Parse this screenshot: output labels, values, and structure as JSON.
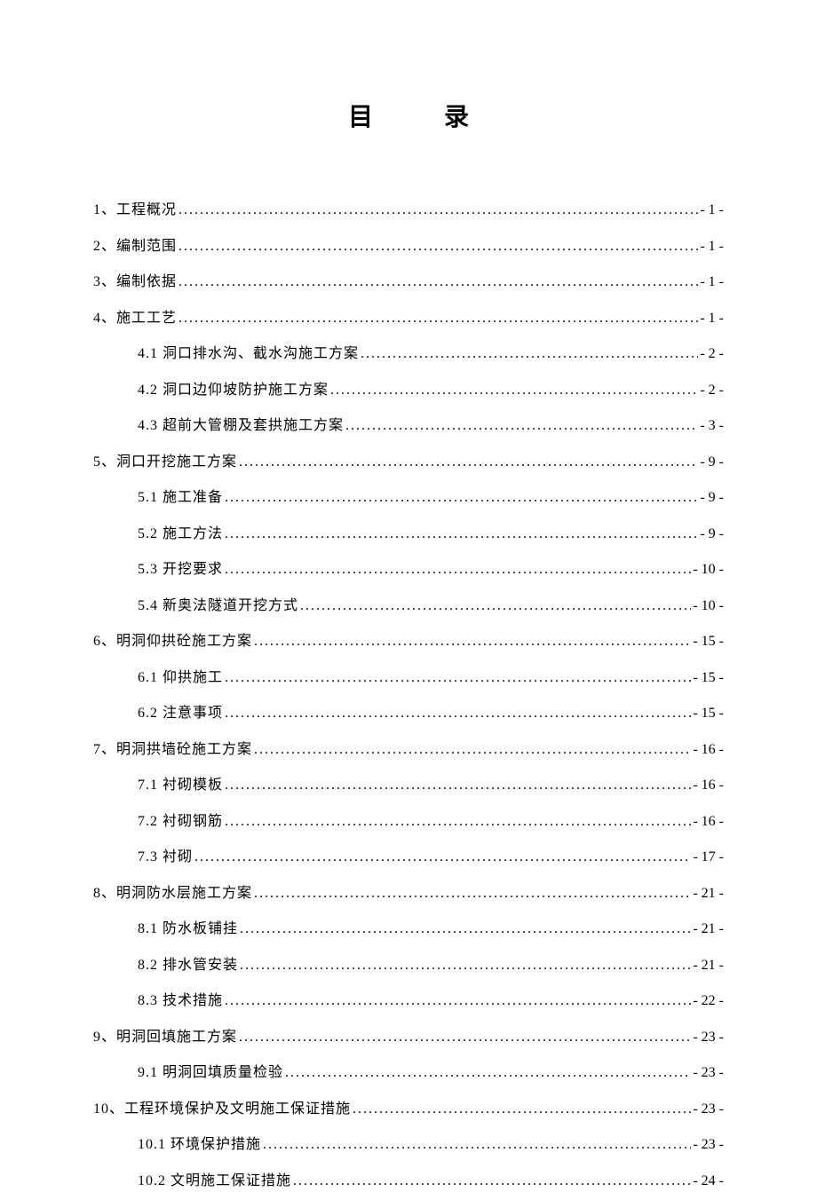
{
  "title": "目录",
  "toc": [
    {
      "level": 1,
      "label": "1、工程概况 ",
      "page": "- 1 -"
    },
    {
      "level": 1,
      "label": "2、编制范围 ",
      "page": "- 1 -"
    },
    {
      "level": 1,
      "label": "3、编制依据 ",
      "page": "- 1 -"
    },
    {
      "level": 1,
      "label": "4、施工工艺 ",
      "page": "- 1 -"
    },
    {
      "level": 2,
      "label": "4.1 洞口排水沟、截水沟施工方案",
      "page": "- 2 -"
    },
    {
      "level": 2,
      "label": "4.2 洞口边仰坡防护施工方案",
      "page": "- 2 -"
    },
    {
      "level": 2,
      "label": "4.3 超前大管棚及套拱施工方案",
      "page": "- 3 -"
    },
    {
      "level": 1,
      "label": "5、洞口开挖施工方案",
      "page": "- 9 -"
    },
    {
      "level": 2,
      "label": "5.1 施工准备",
      "page": "- 9 -"
    },
    {
      "level": 2,
      "label": "5.2 施工方法",
      "page": "- 9 -"
    },
    {
      "level": 2,
      "label": "5.3 开挖要求",
      "page": "- 10 -"
    },
    {
      "level": 2,
      "label": "5.4 新奥法隧道开挖方式 ",
      "page": "- 10 -"
    },
    {
      "level": 1,
      "label": "6、明洞仰拱砼施工方案",
      "page": "- 15 -"
    },
    {
      "level": 2,
      "label": "6.1 仰拱施工",
      "page": "- 15 -"
    },
    {
      "level": 2,
      "label": "6.2 注意事项",
      "page": "- 15 -"
    },
    {
      "level": 1,
      "label": "7、明洞拱墙砼施工方案",
      "page": "- 16 -"
    },
    {
      "level": 2,
      "label": "7.1 衬砌模板",
      "page": "- 16 -"
    },
    {
      "level": 2,
      "label": "7.2 衬砌钢筋",
      "page": "- 16 -"
    },
    {
      "level": 2,
      "label": "7.3 衬砌",
      "page": "- 17 -"
    },
    {
      "level": 1,
      "label": "8、明洞防水层施工方案",
      "page": "- 21 -"
    },
    {
      "level": 2,
      "label": "8.1 防水板铺挂 ",
      "page": "- 21 -"
    },
    {
      "level": 2,
      "label": "8.2 排水管安装 ",
      "page": "- 21 -"
    },
    {
      "level": 2,
      "label": "8.3 技术措施",
      "page": "- 22 -"
    },
    {
      "level": 1,
      "label": "9、明洞回填施工方案",
      "page": "- 23 -"
    },
    {
      "level": 2,
      "label": "9.1 明洞回填质量检验 ",
      "page": "- 23 -"
    },
    {
      "level": 1,
      "label": "10、工程环境保护及文明施工保证措施 ",
      "page": "- 23 -"
    },
    {
      "level": 2,
      "label": "10.1 环境保护措施 ",
      "page": "- 23 -"
    },
    {
      "level": 2,
      "label": "10.2 文明施工保证措施 ",
      "page": "- 24 -"
    }
  ]
}
